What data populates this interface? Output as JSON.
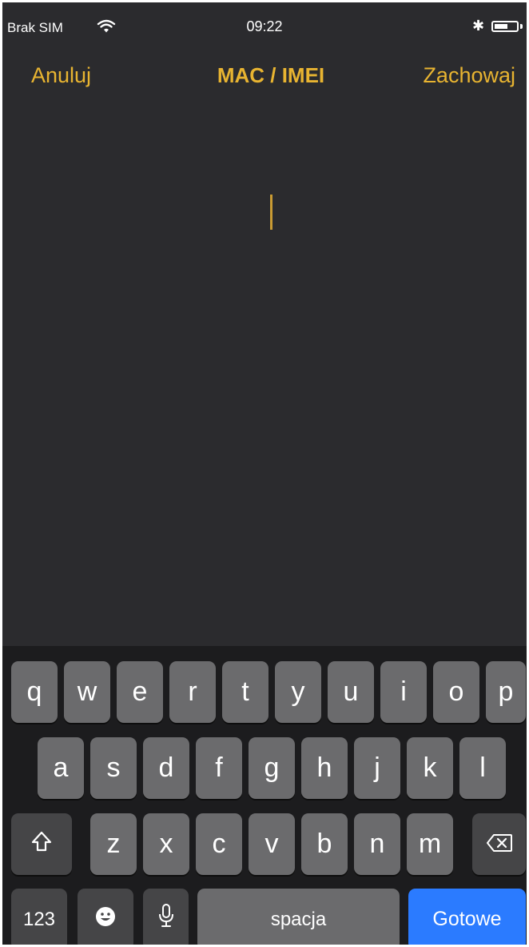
{
  "status_bar": {
    "carrier": "Brak SIM",
    "time": "09:22",
    "bluetooth_symbol": "✱",
    "battery_level": 0.6,
    "icons": [
      "wifi-icon",
      "bluetooth-icon",
      "battery-icon"
    ]
  },
  "nav": {
    "cancel": "Anuluj",
    "title": "MAC / IMEI",
    "save": "Zachowaj"
  },
  "input": {
    "value": ""
  },
  "colors": {
    "accent": "#e8b431",
    "background": "#2b2b2e",
    "keyboard_bg": "#1c1c1e",
    "key": "#6b6b6d",
    "key_function": "#454547",
    "done_key": "#2b7bff"
  },
  "keyboard": {
    "row1": [
      "q",
      "w",
      "e",
      "r",
      "t",
      "y",
      "u",
      "i",
      "o",
      "p"
    ],
    "row2": [
      "a",
      "s",
      "d",
      "f",
      "g",
      "h",
      "j",
      "k",
      "l"
    ],
    "row3": [
      "z",
      "x",
      "c",
      "v",
      "b",
      "n",
      "m"
    ],
    "numbers": "123",
    "space": "spacja",
    "done": "Gotowe",
    "shift_icon": "shift-icon",
    "backspace_icon": "backspace-icon",
    "emoji_icon": "emoji-icon",
    "mic_icon": "microphone-icon"
  }
}
